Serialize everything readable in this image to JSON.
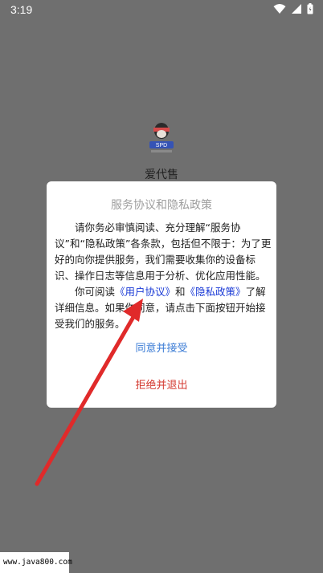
{
  "status_bar": {
    "time": "3:19"
  },
  "app": {
    "name": "爱代售"
  },
  "dialog": {
    "title": "服务协议和隐私政策",
    "para1": "请你务必审慎阅读、充分理解“服务协议”和“隐私政策”各条款，包括但不限于：为了更好的向你提供服务，我们需要收集你的设备标识、操作日志等信息用于分析、优化应用性能。",
    "para2_prefix": "你可阅读",
    "user_agreement_link": "《用户协议》",
    "and": "和",
    "privacy_link": "《隐私政策》",
    "para2_suffix": "了解详细信息。如果你同意，请点击下面按钮开始接受我们的服务。",
    "agree_label": "同意并接受",
    "reject_label": "拒绝并退出"
  },
  "watermark": {
    "text": "www.java800.com"
  },
  "colors": {
    "overlay": "#6f6f6f",
    "link": "#1a3ad6",
    "agree": "#3a7bd5",
    "reject": "#d43a30",
    "arrow": "#e02a2a"
  }
}
